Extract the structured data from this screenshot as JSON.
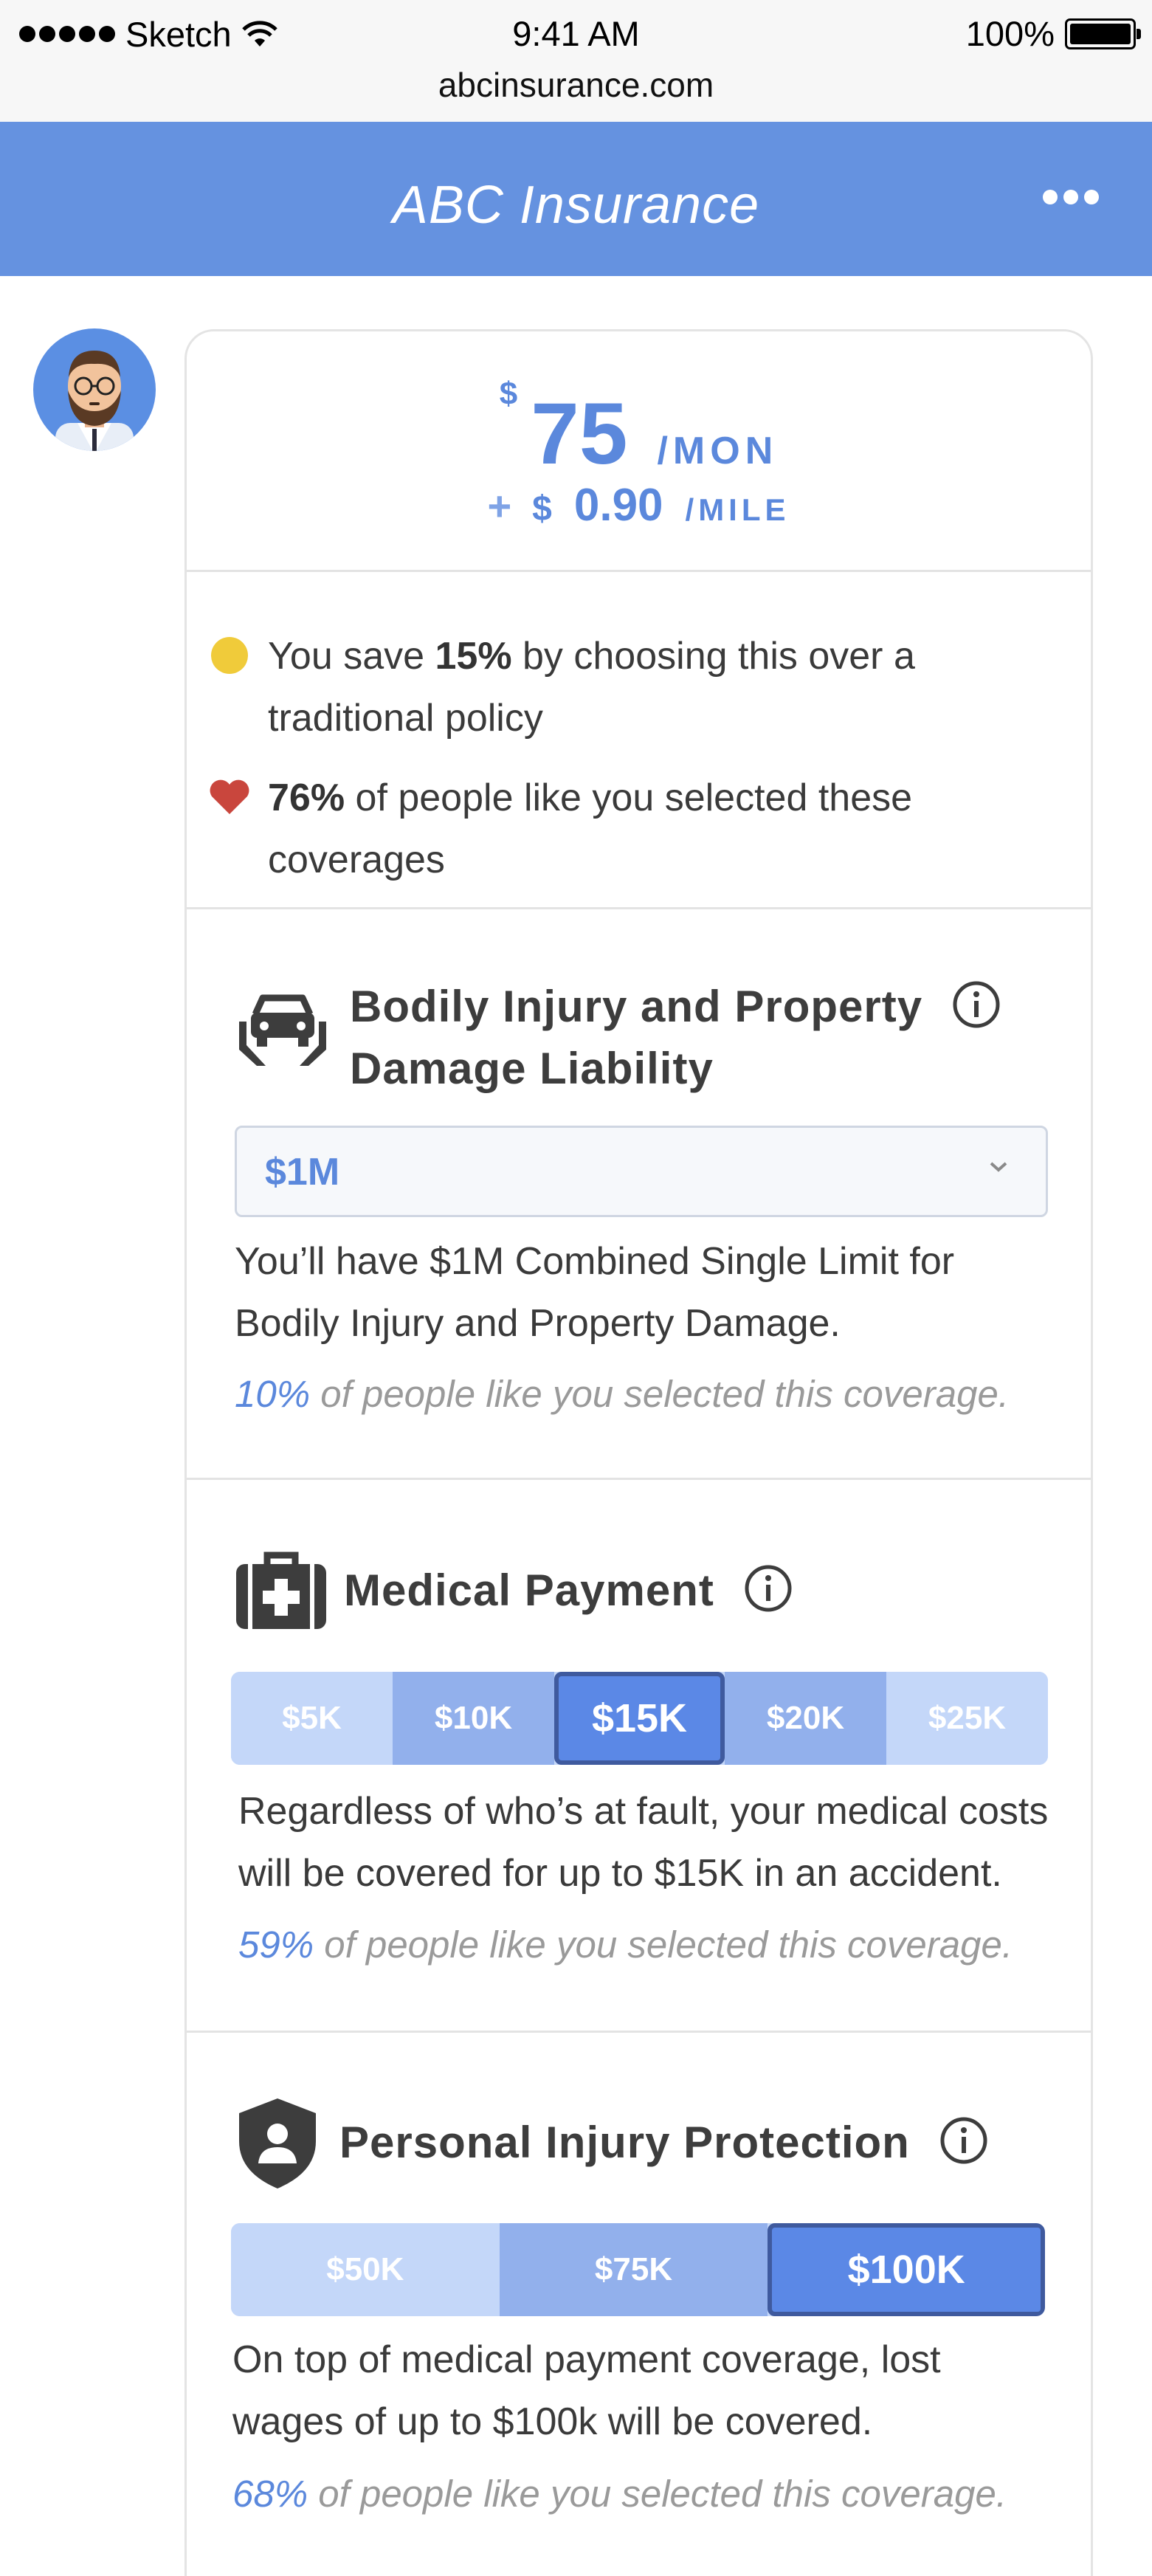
{
  "status_bar": {
    "carrier": "Sketch",
    "time": "9:41 AM",
    "battery": "100%",
    "url": "abcinsurance.com"
  },
  "header": {
    "title": "ABC Insurance",
    "more_icon": "more-icon"
  },
  "colors": {
    "accent": "#6592e0",
    "price": "#5b88dc",
    "segment_light": "#c4d7f9",
    "segment_mid": "#92b0ec",
    "segment_selected": "#5b88e6",
    "heart": "#c9463d",
    "coin": "#f0cb3a"
  },
  "price": {
    "currency": "$",
    "monthly_amount": "75",
    "monthly_unit": "/MON",
    "plus": "+",
    "per_mile_currency": "$",
    "per_mile_amount": "0.90",
    "per_mile_unit": "/MILE"
  },
  "notes": {
    "savings": {
      "icon": "coin-icon",
      "prefix": "You save ",
      "highlight": "15%",
      "rest": " by choosing this over a traditional policy"
    },
    "popularity": {
      "icon": "heart-icon",
      "highlight": "76%",
      "rest": " of people like you selected these coverages"
    }
  },
  "coverages": {
    "bodily": {
      "icon": "car-hands-icon",
      "title_line1": "Bodily Injury and Property",
      "title_line2": "Damage Liability",
      "selected_value": "$1M",
      "description": "You’ll have $1M Combined Single Limit for Bodily Injury and Property Damage.",
      "stat_pct": "10%",
      "stat_text": " of people like you selected this coverage."
    },
    "medical": {
      "icon": "medical-kit-icon",
      "title": "Medical Payment",
      "options": [
        "$5K",
        "$10K",
        "$15K",
        "$20K",
        "$25K"
      ],
      "selected": "$15K",
      "description": "Regardless of who’s at fault, your medical costs will be covered for up to $15K in an accident.",
      "stat_pct": "59%",
      "stat_text": " of people like you selected this coverage."
    },
    "pip": {
      "icon": "shield-person-icon",
      "title": "Personal Injury Protection",
      "options": [
        "$50K",
        "$75K",
        "$100K"
      ],
      "selected": "$100K",
      "description": "On top of medical payment coverage, lost wages of up to $100k will be covered.",
      "stat_pct": "68%",
      "stat_text": " of people like you selected this coverage."
    }
  }
}
